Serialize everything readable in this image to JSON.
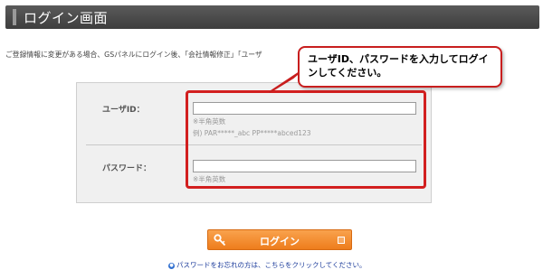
{
  "header": {
    "title": "ログイン画面"
  },
  "intro": {
    "text": "ご登録情報に変更がある場合、GSパネルにログイン後、「会社情報修正」「ユーザ"
  },
  "callout": {
    "text": "ユーザID、パスワードを入力してログインしてください。"
  },
  "form": {
    "user_id": {
      "label": "ユーザID：",
      "value": "",
      "hint": "※半角英数",
      "example": "例) PAR*****_abc    PP*****abced123"
    },
    "password": {
      "label": "パスワード：",
      "value": "",
      "hint": "※半角英数"
    }
  },
  "login_button": {
    "label": "ログイン",
    "icon": "key-icon"
  },
  "forgot": {
    "text": "パスワードをお忘れの方は、こちらをクリックしてください。",
    "icon": "info-icon"
  },
  "colors": {
    "header_bg": "#464646",
    "button_orange": "#f28a2e",
    "highlight_red": "#d21f1f"
  }
}
